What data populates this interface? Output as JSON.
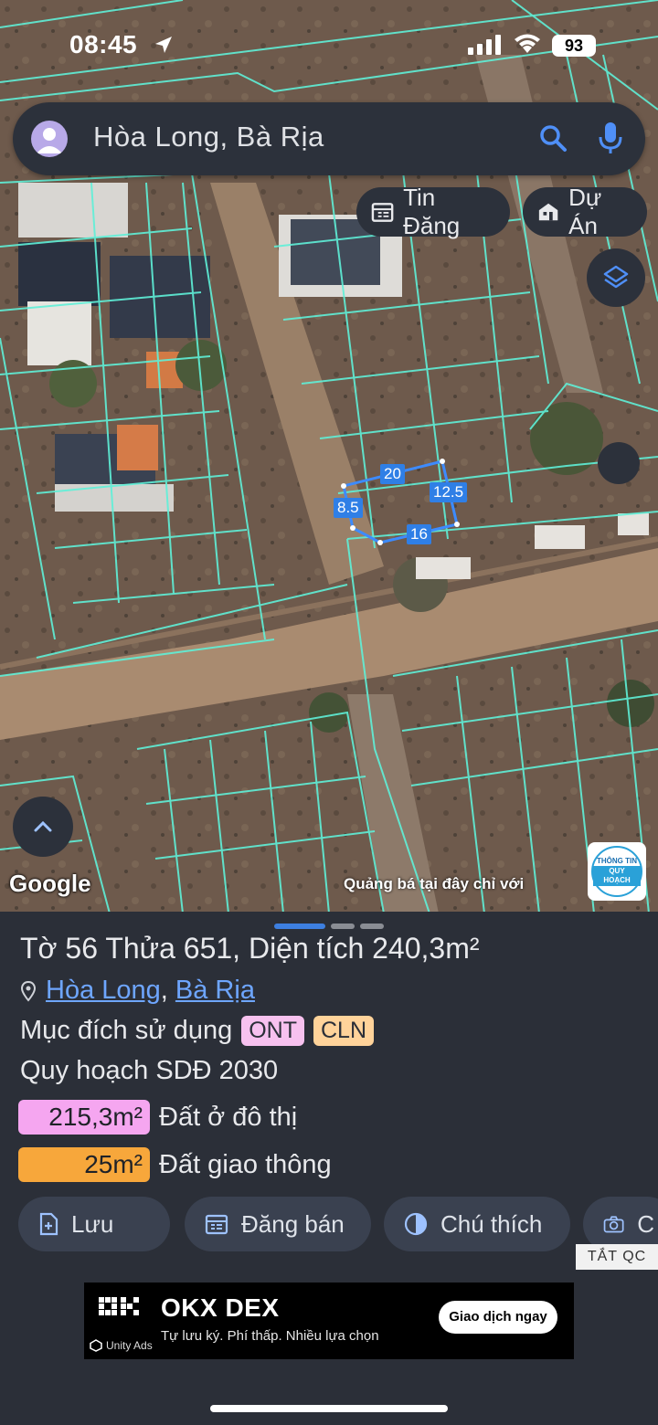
{
  "status_bar": {
    "time": "08:45",
    "battery": "93"
  },
  "search": {
    "text": "Hòa Long, Bà Rịa"
  },
  "chips": {
    "tin_dang": "Tin Đăng",
    "du_an": "Dự Án"
  },
  "map": {
    "attribution": "Google",
    "ad_caption": "Quảng bá tại đây chỉ với",
    "logo_top": "THÔNG TIN",
    "logo_bottom": "QUY HOẠCH",
    "dimensions": {
      "top": "20",
      "right": "12.5",
      "left": "8.5",
      "bottom": "16"
    }
  },
  "parcel": {
    "title_prefix": "Tờ",
    "sheet_no": "56",
    "plot_label": "Thửa",
    "plot_no": "651",
    "area_label": ", Diện tích",
    "area": "240,3m²",
    "location": {
      "commune": "Hòa Long",
      "sep": ",",
      "district": "Bà Rịa"
    },
    "purpose_label": "Mục đích sử dụng",
    "purpose_tags": [
      "ONT",
      "CLN"
    ],
    "plan_label": "Quy hoạch SDĐ 2030",
    "plan_rows": [
      {
        "value": "215,3m²",
        "label": "Đất ở đô thị",
        "color": "#f5a6f0"
      },
      {
        "value": "25m²",
        "label": "Đất giao thông",
        "color": "#f7a73b"
      }
    ]
  },
  "actions": {
    "save": "Lưu",
    "sell": "Đăng bán",
    "legend": "Chú thích",
    "camera": "C"
  },
  "ad": {
    "toggle": "TẮT QC",
    "brand": "OKX DEX",
    "tagline": "Tự lưu ký. Phí thấp. Nhiều lựa chọn",
    "cta": "Giao dịch ngay",
    "network": "Unity Ads"
  },
  "colors": {
    "accent": "#3d7fe0",
    "parcel_lines": "#5ff0d8",
    "sheet_bg": "#2b2f38"
  }
}
